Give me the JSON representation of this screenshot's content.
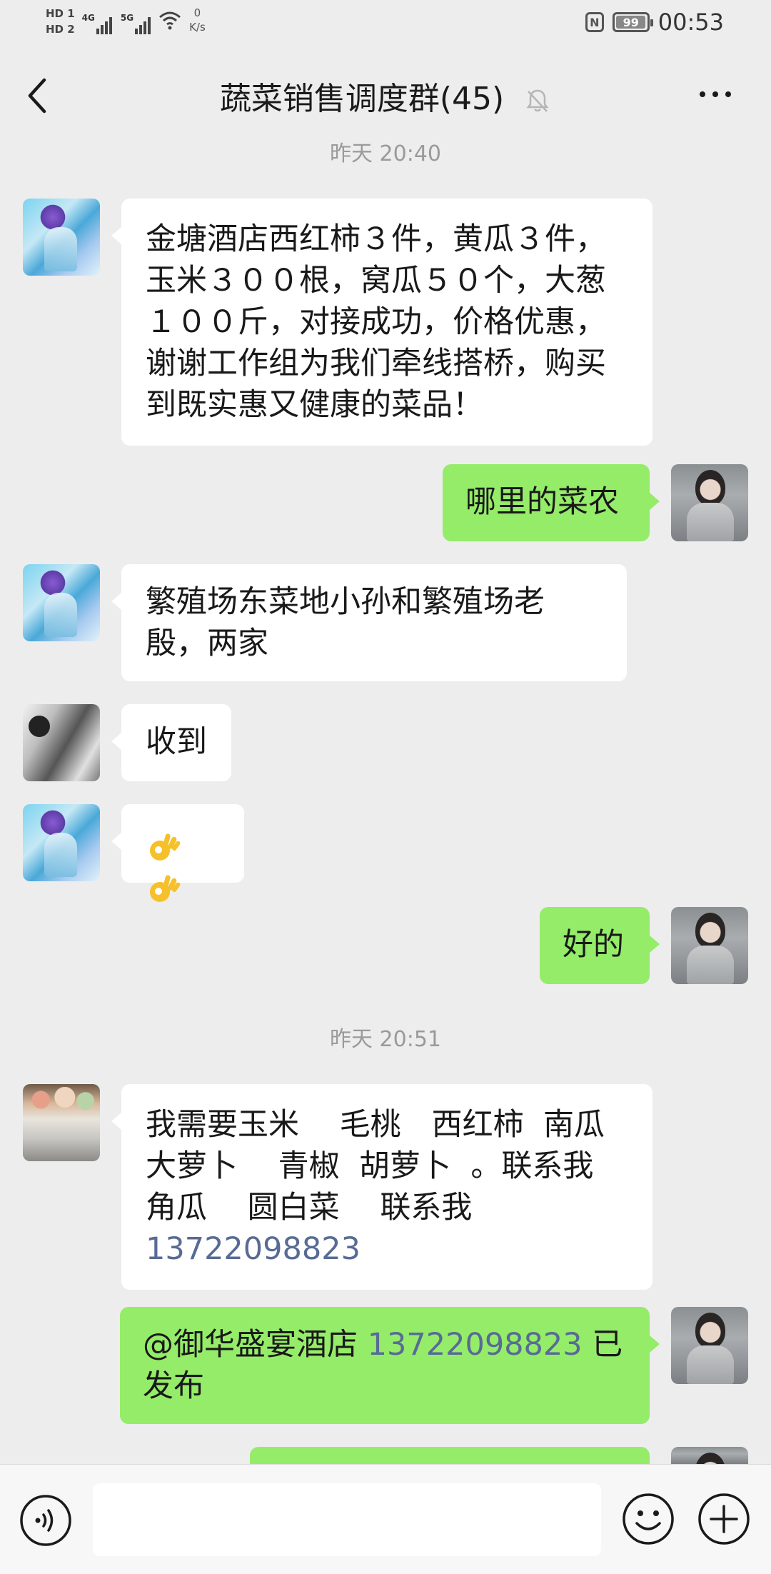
{
  "status_bar": {
    "hd1": "HD 1",
    "hd2": "HD 2",
    "net1": "4G",
    "net2": "5G",
    "speed_value": "0",
    "speed_unit": "K/s",
    "nfc": "N",
    "battery": "99",
    "battery_level": 0.99,
    "time": "00:53"
  },
  "header": {
    "title": "蔬菜销售调度群(45)",
    "back_icon": "chevron-left-icon",
    "mute_icon": "bell-off-icon",
    "more_icon": "more-dots-icon"
  },
  "messages": {
    "ts1": "昨天 20:40",
    "m1": "金塘酒店西红柿３件，黄瓜３件，玉米３００根，窝瓜５０个，大葱１００斤，对接成功，价格优惠，谢谢工作组为我们牵线搭桥，购买到既实惠又健康的菜品！",
    "m2": "哪里的菜农",
    "m3": "繁殖场东菜地小孙和繁殖场老殷，两家",
    "m4": "收到",
    "m5_emoji": "ok-hand-emoji",
    "m6": "好的",
    "ts2": "昨天 20:51",
    "m7_lines": [
      "我需要玉米　 毛桃　西红柿  南瓜",
      "大萝卜　 青椒  胡萝卜  。联系我",
      "角瓜　 圆白菜　 联系我"
    ],
    "m7_phone": "13722098823",
    "m8_prefix": "@御华盛宴酒店 ",
    "m8_phone": "13722098823",
    "m8_suffix": " 已发布"
  },
  "input_bar": {
    "voice_icon": "voice-icon",
    "emoji_icon": "smile-icon",
    "plus_icon": "plus-icon"
  },
  "colors": {
    "background": "#ededed",
    "bubble_in": "#ffffff",
    "bubble_out": "#95ec69",
    "link": "#576b95"
  }
}
